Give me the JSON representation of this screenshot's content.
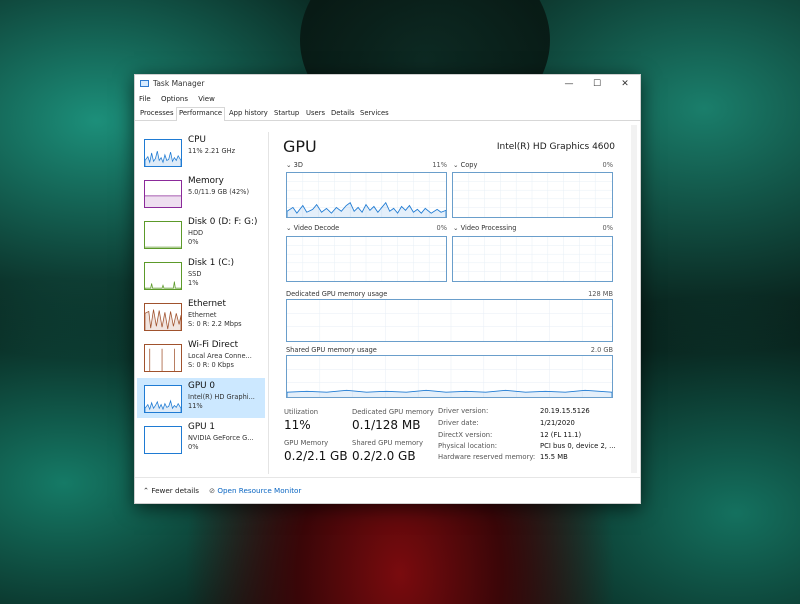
{
  "window": {
    "title": "Task Manager",
    "controls": {
      "minimize": "—",
      "maximize": "☐",
      "close": "✕"
    }
  },
  "menu": [
    "File",
    "Options",
    "View"
  ],
  "tabs": [
    "Processes",
    "Performance",
    "App history",
    "Startup",
    "Users",
    "Details",
    "Services"
  ],
  "active_tab": "Performance",
  "sidebar": {
    "items": [
      {
        "name": "CPU",
        "line1": "11% 2.21 GHz",
        "line2": "",
        "line3": "",
        "color": "#1f7bd3",
        "selected": false
      },
      {
        "name": "Memory",
        "line1": "5.0/11.9 GB (42%)",
        "line2": "",
        "line3": "",
        "color": "#8b2a9a",
        "selected": false
      },
      {
        "name": "Disk 0 (D: F: G:)",
        "line1": "HDD",
        "line2": "0%",
        "line3": "",
        "color": "#5c9a2a",
        "selected": false
      },
      {
        "name": "Disk 1 (C:)",
        "line1": "SSD",
        "line2": "1%",
        "line3": "",
        "color": "#5c9a2a",
        "selected": false
      },
      {
        "name": "Ethernet",
        "line1": "Ethernet",
        "line2": "S: 0 R: 2.2 Mbps",
        "line3": "",
        "color": "#a0522d",
        "selected": false
      },
      {
        "name": "Wi-Fi Direct",
        "line1": "Local Area Conne...",
        "line2": "S: 0 R: 0 Kbps",
        "line3": "",
        "color": "#a0522d",
        "selected": false
      },
      {
        "name": "GPU 0",
        "line1": "Intel(R) HD Graphi...",
        "line2": "11%",
        "line3": "",
        "color": "#1f7bd3",
        "selected": true
      },
      {
        "name": "GPU 1",
        "line1": "NVIDIA GeForce G...",
        "line2": "0%",
        "line3": "",
        "color": "#1f7bd3",
        "selected": false
      }
    ]
  },
  "main": {
    "title": "GPU",
    "adapter": "Intel(R) HD Graphics 4600",
    "engines": [
      {
        "label": "3D",
        "value": "11%"
      },
      {
        "label": "Copy",
        "value": "0%"
      },
      {
        "label": "Video Decode",
        "value": "0%"
      },
      {
        "label": "Video Processing",
        "value": "0%"
      }
    ],
    "dedicated": {
      "label": "Dedicated GPU memory usage",
      "max": "128 MB"
    },
    "shared": {
      "label": "Shared GPU memory usage",
      "max": "2.0 GB"
    },
    "stats": {
      "utilization_label": "Utilization",
      "utilization": "11%",
      "dedicated_label": "Dedicated GPU memory",
      "dedicated": "0.1/128 MB",
      "gpu_mem_label": "GPU Memory",
      "gpu_mem": "0.2/2.1 GB",
      "shared_label": "Shared GPU memory",
      "shared": "0.2/2.0 GB"
    },
    "info": [
      {
        "key": "Driver version:",
        "value": "20.19.15.5126"
      },
      {
        "key": "Driver date:",
        "value": "1/21/2020"
      },
      {
        "key": "DirectX version:",
        "value": "12 (FL 11.1)"
      },
      {
        "key": "Physical location:",
        "value": "PCI bus 0, device 2, ..."
      },
      {
        "key": "Hardware reserved memory:",
        "value": "15.5 MB"
      }
    ]
  },
  "footer": {
    "fewer_details": "Fewer details",
    "open_resource_monitor": "Open Resource Monitor"
  },
  "colors": {
    "graph_border": "#6a9ecb",
    "selected_bg": "#cce8ff",
    "link": "#0b66c2"
  }
}
